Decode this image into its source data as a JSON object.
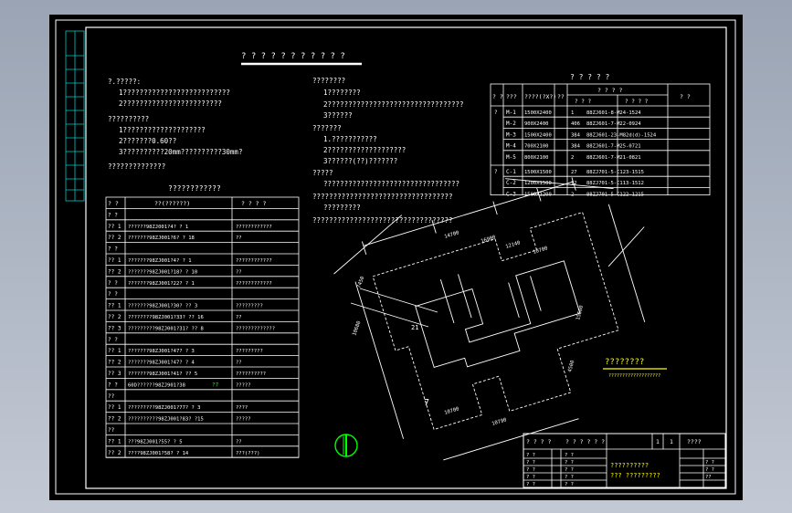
{
  "drawing_title": "? ? ? ? ? ? ? ? ? ? ?",
  "notes_left": {
    "lines": [
      "?.?????:",
      "1??????????????????????????",
      "2????????????????????????",
      "??????????",
      "1????????????????????",
      "2???????0.60??",
      "3??????????20mm??????????30mm?",
      "??????????????"
    ]
  },
  "notes_right": {
    "lines": [
      "????????",
      "1????????",
      "2?????????????????????????????????",
      "3??????",
      "???????",
      "1.???????????",
      "2???????????????????",
      "3??????(??)???????",
      "?????",
      "?????????????????????????????????",
      "??????????????????????????????????",
      "?????????",
      "??????????????????????????????????"
    ]
  },
  "door_table": {
    "title": "? ? ? ? ?",
    "headers": [
      "? ?",
      "???",
      "????(?X?)",
      "??",
      "? ? ? ?",
      "? ?"
    ],
    "subheaders": [
      "? ? ?",
      "? ? ? ?"
    ],
    "rows": [
      [
        "?",
        "M-1",
        "1500X2400",
        "1",
        "88ZJ601-8-M24-1524"
      ],
      [
        "",
        "M-2",
        "900X2400",
        "406",
        "88ZJ601-7-M22-0924"
      ],
      [
        "",
        "M-3",
        "1500X2400",
        "384",
        "88ZJ601-23-M82d(d)-1524"
      ],
      [
        "",
        "M-4",
        "700X2100",
        "384",
        "88ZJ601-7-M25-0721"
      ],
      [
        "",
        "M-5",
        "800X2100",
        "2",
        "88ZJ601-7-M21-0821"
      ],
      [
        "?",
        "C-1",
        "1500X1500",
        "27",
        "88ZJ701-5-C123-1515"
      ],
      [
        "",
        "C-2",
        "1200X1500",
        "12",
        "88ZJ701-5-C113-1512"
      ],
      [
        "",
        "C-3",
        "1500X1200",
        "2",
        "88ZJ701-5-C122-1215"
      ]
    ]
  },
  "construction_table": {
    "title": "????????????",
    "headers": [
      "? ?",
      "??(??????)",
      "? ? ? ?"
    ],
    "rows": [
      [
        "? ?",
        "",
        ""
      ],
      [
        "?? 1",
        "??????98ZJ001?4? ? 1",
        "????????????"
      ],
      [
        "?? 2",
        "???????98ZJ001?6? ? 18",
        "??"
      ],
      [
        "? ?",
        "",
        ""
      ],
      [
        "?? 1",
        "???????98ZJ001?4? ? 1",
        "????????????"
      ],
      [
        "?? 2",
        "???????98ZJ001?18? ? 10",
        "??"
      ],
      [
        "? ?",
        "???????98ZJ001?22? ? 1",
        "????????????"
      ],
      [
        "? ?",
        "",
        ""
      ],
      [
        "?? 1",
        "???????98ZJ001?30? ?? 3",
        "?????????"
      ],
      [
        "?? 2",
        "????????98ZJ001?33? ?? 16",
        "??"
      ],
      [
        "?? 3",
        "?????????98ZJ001?31? ?? 8",
        "?????????????"
      ],
      [
        "? ?",
        "",
        ""
      ],
      [
        "?? 1",
        "???????98ZJ001?47? ? 3",
        "?????????"
      ],
      [
        "?? 2",
        "???????98ZJ001?47? ? 4",
        "??"
      ],
      [
        "?? 3",
        "???????98ZJ001?41? ?? 5",
        "??????????"
      ],
      [
        "? ?",
        "60D??????98ZJ901?38",
        "?????"
      ],
      [
        "??",
        "",
        ""
      ],
      [
        "?? 1",
        "?????????98ZJ001?77? ? 3",
        "????"
      ],
      [
        "?? 2",
        "??????????98ZJ001?83? ?15",
        "?????"
      ],
      [
        "??",
        "",
        ""
      ],
      [
        "?? 1",
        "???98ZJ001?55? ? 5",
        "??"
      ],
      [
        "?? 2",
        "????98ZJ001?58? ? 14",
        "???(???)"
      ]
    ],
    "highlight_badge": "?7"
  },
  "plan": {
    "dimensions": [
      "14700",
      "16900",
      "12140",
      "10700",
      "7450",
      "10680",
      "15500",
      "4500",
      "10700",
      "10790",
      "21",
      "7"
    ],
    "label_main": "????????",
    "label_sub": "???????????????????"
  },
  "title_block": {
    "cells_row1": [
      "? ? ? ?",
      "? ? ? ? ? ?",
      "1",
      "1",
      "????"
    ],
    "yellow_line1": "??????????",
    "yellow_line2": "???      ?????????",
    "left_cells": [
      "? ?",
      "? ?",
      "? ?",
      "? ?",
      "? ?",
      "? ?"
    ],
    "right_cells": [
      "? ?",
      "? ?",
      "??"
    ]
  },
  "colors": {
    "background": "#000000",
    "lines": "#ffffff",
    "title_yellow": "#ffff00",
    "north_green": "#00ff00",
    "frame_cyan": "#00c8c8"
  }
}
